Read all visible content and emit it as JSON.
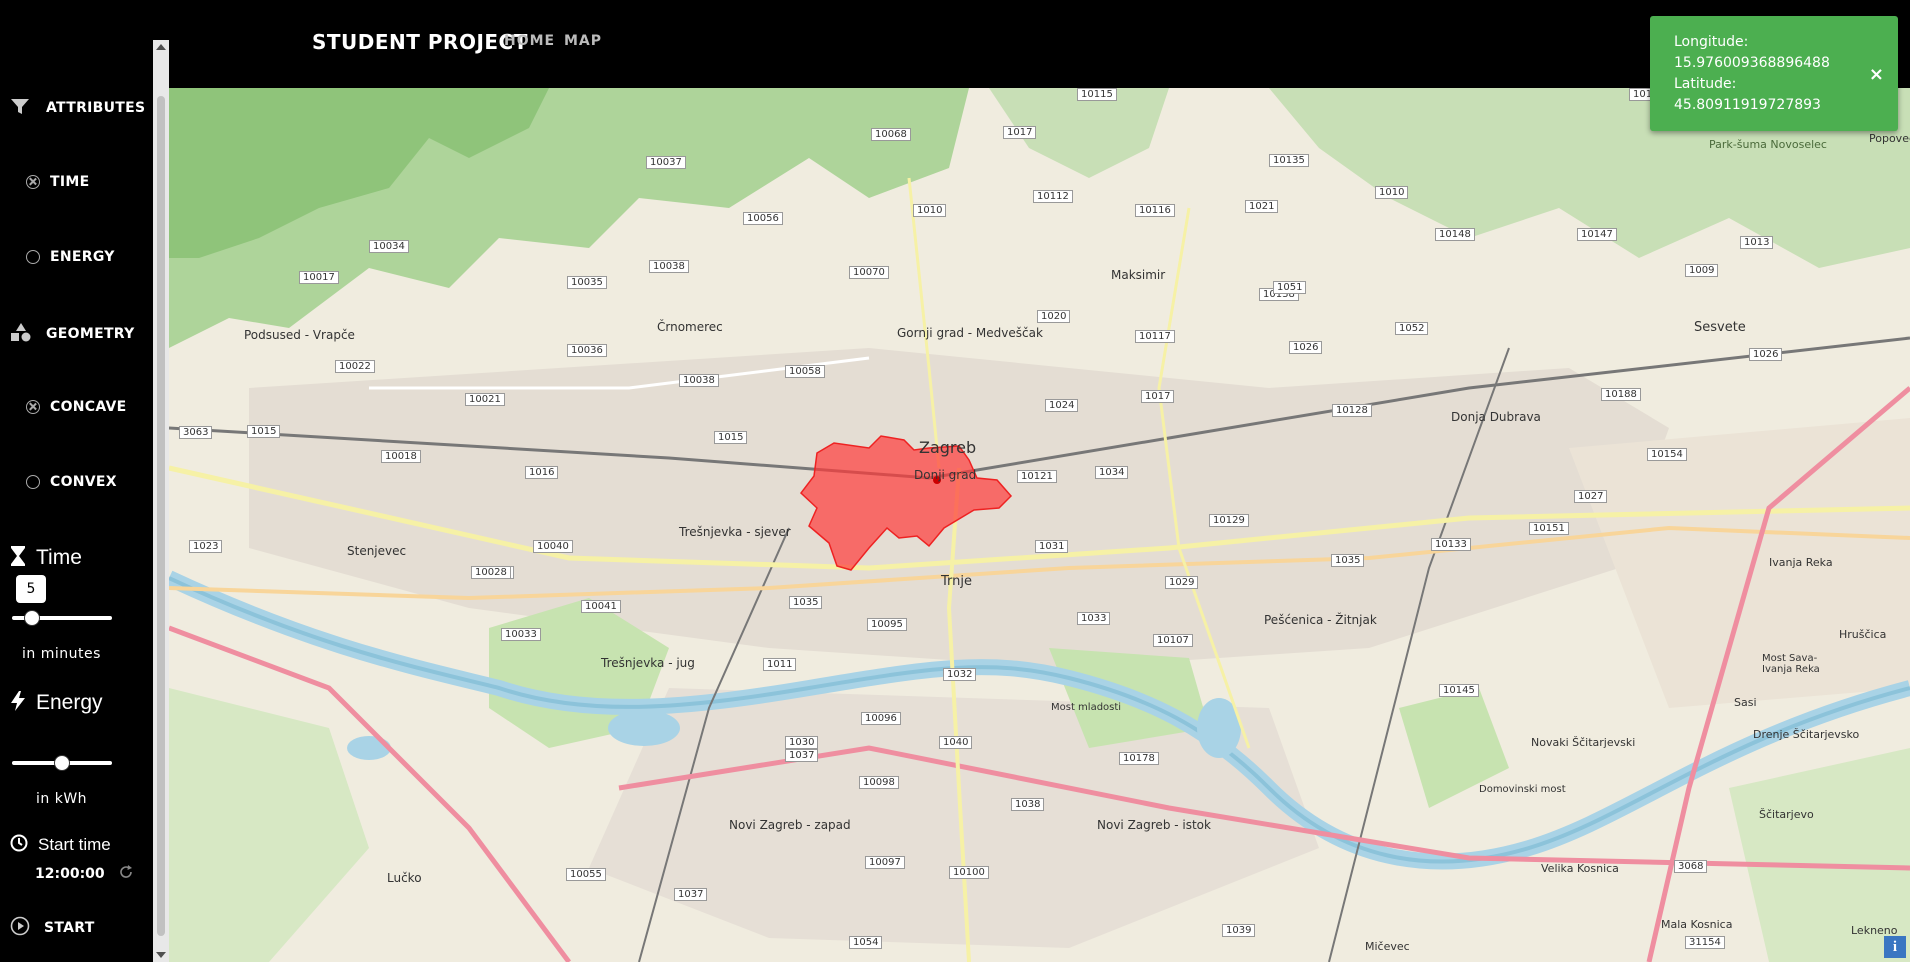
{
  "header": {
    "brand": "STUDENT PROJECT",
    "nav": [
      {
        "label": "HOME"
      },
      {
        "label": "MAP"
      }
    ]
  },
  "sidebar": {
    "attributes_label": "ATTRIBUTES",
    "time_option": "TIME",
    "energy_option": "ENERGY",
    "geometry_label": "GEOMETRY",
    "concave_option": "CONCAVE",
    "convex_option": "CONVEX",
    "time_title": "Time",
    "time_value": "5",
    "time_unit": "in minutes",
    "time_slider_fraction": 0.2,
    "energy_title": "Energy",
    "energy_unit": "in kWh",
    "energy_slider_fraction": 0.5,
    "start_time_title": "Start time",
    "start_time_value": "12:00:00",
    "start_label": "START"
  },
  "toast": {
    "longitude_label": "Longitude:",
    "longitude_value": "15.976009368896488",
    "latitude_label": "Latitude:",
    "latitude_value": "45.80911919727893",
    "close": "×"
  },
  "map": {
    "info": "i",
    "places": [
      {
        "name": "Zagreb"
      },
      {
        "name": "Donji grad"
      },
      {
        "name": "Trnje"
      },
      {
        "name": "Trešnjevka - sjever"
      },
      {
        "name": "Trešnjevka - jug"
      },
      {
        "name": "Črnomerec"
      },
      {
        "name": "Gornji grad - Medveščak"
      },
      {
        "name": "Maksimir"
      },
      {
        "name": "Podsused - Vrapče"
      },
      {
        "name": "Stenjevec"
      },
      {
        "name": "Novi Zagreb - zapad"
      },
      {
        "name": "Novi Zagreb - istok"
      },
      {
        "name": "Sesvete"
      },
      {
        "name": "Donja Dubrava"
      },
      {
        "name": "Pešćenica - Žitnjak"
      },
      {
        "name": "Lučko"
      },
      {
        "name": "Sesvete"
      },
      {
        "name": "Ivanja Reka"
      },
      {
        "name": "Hruščica"
      },
      {
        "name": "Sasi"
      },
      {
        "name": "Novaki Ščitarjevski"
      },
      {
        "name": "Drenje Ščitarjevsko"
      },
      {
        "name": "Ščitarjevo"
      },
      {
        "name": "Velika Kosnica"
      },
      {
        "name": "Mala Kosnica"
      },
      {
        "name": "Mičevec"
      },
      {
        "name": "Domovinski most"
      },
      {
        "name": "Most mladosti"
      },
      {
        "name": "Most Sava-Ivanja Reka"
      },
      {
        "name": "Lekneno"
      },
      {
        "name": "Popovec"
      },
      {
        "name": "Park-šuma Novoselec"
      }
    ]
  },
  "colors": {
    "sidebar_bg": "#000000",
    "toast_bg": "#4caf50",
    "isochrone_fill": "#ff3b3b",
    "map_bg": "#f0ecdf",
    "forest": "#aed49a"
  }
}
